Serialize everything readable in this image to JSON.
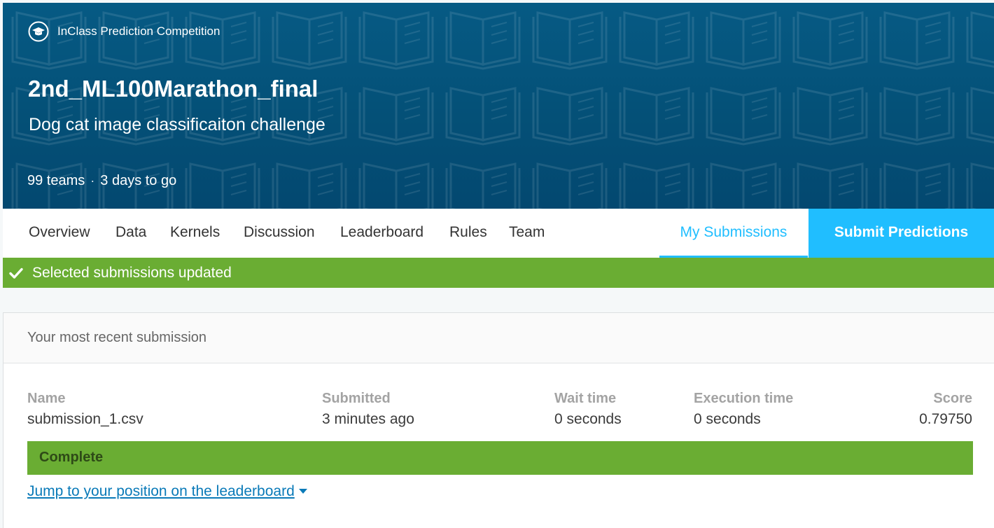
{
  "competition": {
    "type_label": "InClass Prediction Competition",
    "type_icon": "graduation-cap-icon",
    "title": "2nd_ML100Marathon_final",
    "subtitle": "Dog cat image classificaiton challenge",
    "teams": "99 teams",
    "separator": "·",
    "deadline": "3 days to go"
  },
  "nav": {
    "tabs": [
      {
        "label": "Overview"
      },
      {
        "label": "Data"
      },
      {
        "label": "Kernels"
      },
      {
        "label": "Discussion"
      },
      {
        "label": "Leaderboard"
      },
      {
        "label": "Rules"
      },
      {
        "label": "Team"
      }
    ],
    "active_tab": "My Submissions",
    "submit_label": "Submit Predictions"
  },
  "banner": {
    "icon": "checkmark-icon",
    "message": "Selected submissions updated"
  },
  "submission": {
    "header": "Your most recent submission",
    "columns": {
      "name": {
        "label": "Name",
        "value": "submission_1.csv"
      },
      "submitted": {
        "label": "Submitted",
        "value": "3 minutes ago"
      },
      "wait_time": {
        "label": "Wait time",
        "value": "0 seconds"
      },
      "execution_time": {
        "label": "Execution time",
        "value": "0 seconds"
      },
      "score": {
        "label": "Score",
        "value": "0.79750"
      }
    },
    "status": "Complete",
    "jump_link": "Jump to your position on the leaderboard"
  },
  "colors": {
    "header_bg": "#045077",
    "accent": "#20beff",
    "success": "#6aad33",
    "link": "#0a7ab8"
  }
}
